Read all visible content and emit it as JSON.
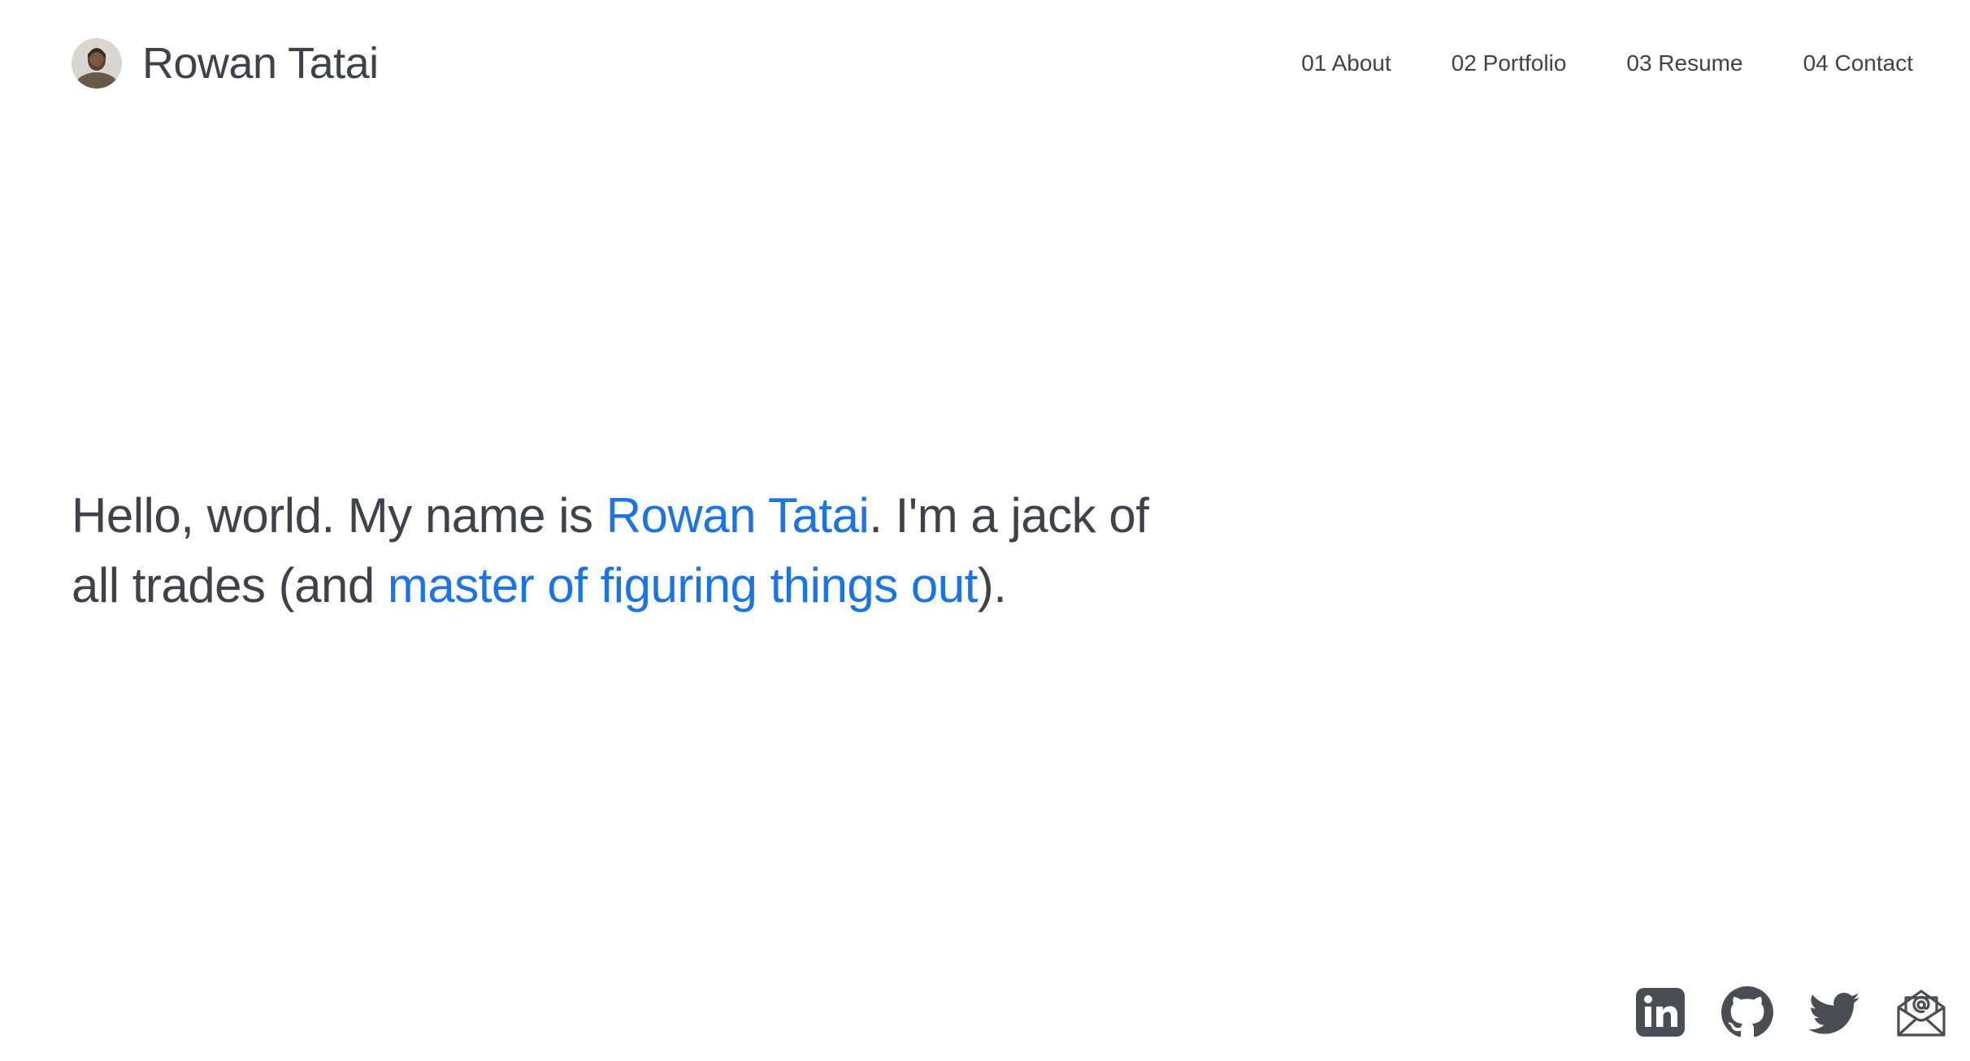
{
  "header": {
    "brand_name": "Rowan Tatai",
    "avatar_alt": "avatar photo"
  },
  "nav": {
    "items": [
      {
        "label": "01 About"
      },
      {
        "label": "02 Portfolio"
      },
      {
        "label": "03 Resume"
      },
      {
        "label": "04 Contact"
      }
    ]
  },
  "hero": {
    "part1": "Hello, world. My name is ",
    "name": "Rowan Tatai",
    "part2": ". I'm a jack of all trades (and ",
    "tagline": "master of figuring things out",
    "part3": ")."
  },
  "social": {
    "icons": [
      "linkedin-icon",
      "github-icon",
      "twitter-icon",
      "email-icon"
    ]
  },
  "colors": {
    "text": "#3f4349",
    "accent": "#1a73e8",
    "icon": "#4a4d52",
    "background": "#ffffff"
  }
}
